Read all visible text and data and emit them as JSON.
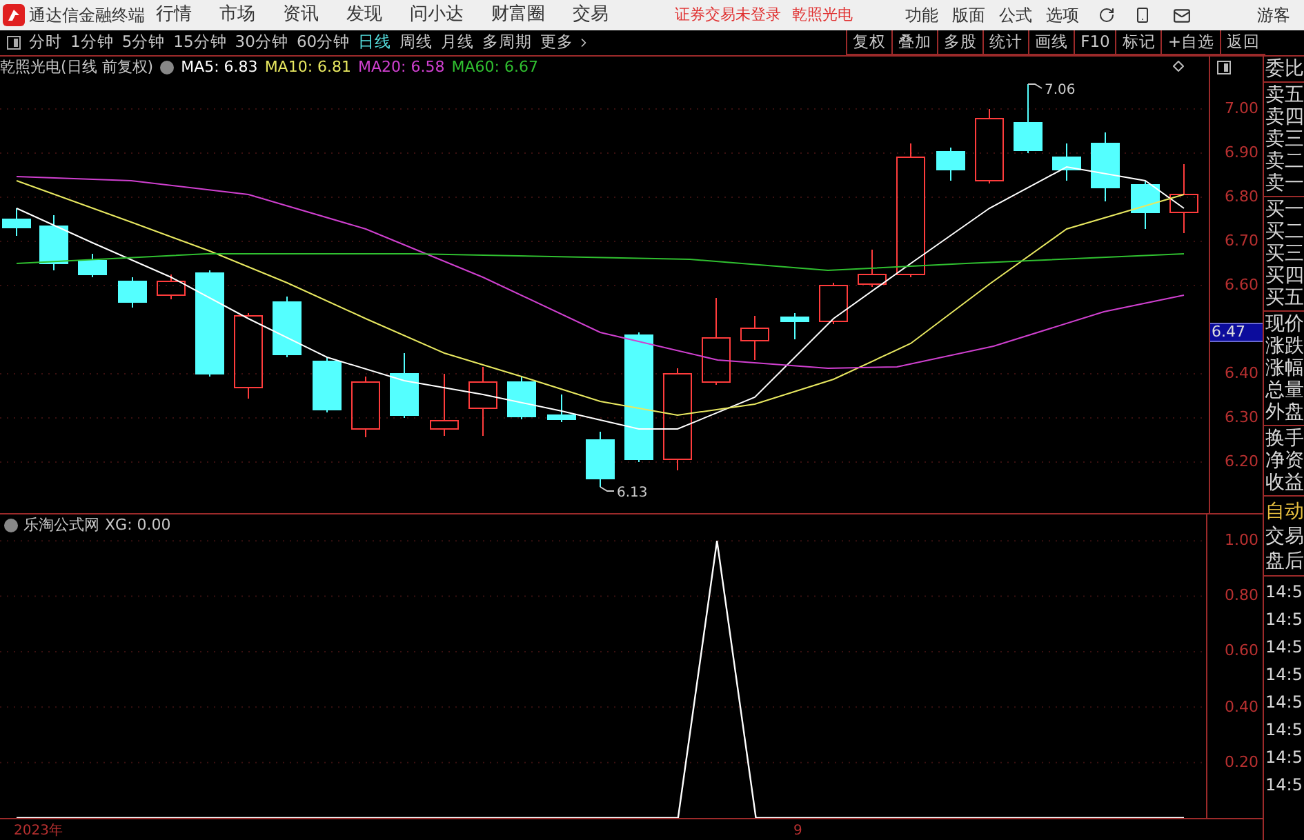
{
  "title_bar": {
    "app_name": "通达信金融终端",
    "menu": [
      "行情",
      "市场",
      "资讯",
      "发现",
      "问小达",
      "财富圈",
      "交易"
    ],
    "status": "证券交易未登录",
    "stock": "乾照光电",
    "right_menu": [
      "功能",
      "版面",
      "公式",
      "选项"
    ],
    "user": "游客"
  },
  "period_tabs": [
    {
      "label": "分时",
      "selected": false
    },
    {
      "label": "1分钟",
      "selected": false
    },
    {
      "label": "5分钟",
      "selected": false
    },
    {
      "label": "15分钟",
      "selected": false
    },
    {
      "label": "30分钟",
      "selected": false
    },
    {
      "label": "60分钟",
      "selected": false
    },
    {
      "label": "日线",
      "selected": true
    },
    {
      "label": "周线",
      "selected": false
    },
    {
      "label": "月线",
      "selected": false
    },
    {
      "label": "多周期",
      "selected": false
    },
    {
      "label": "更多",
      "selected": false
    }
  ],
  "tool_buttons": [
    "复权",
    "叠加",
    "多股",
    "统计",
    "画线",
    "F10",
    "标记",
    "+自选",
    "返回"
  ],
  "main_chart": {
    "title": "乾照光电(日线 前复权)",
    "ma": [
      {
        "label": "MA5: 6.83",
        "color": "#ffffff"
      },
      {
        "label": "MA10: 6.81",
        "color": "#e8e860"
      },
      {
        "label": "MA20: 6.58",
        "color": "#d040d0"
      },
      {
        "label": "MA60: 6.67",
        "color": "#30c030"
      }
    ],
    "price_labels": [
      "7.00",
      "6.90",
      "6.80",
      "6.70",
      "6.60",
      "6.40",
      "6.30",
      "6.20"
    ],
    "current_price": "6.47",
    "high_label": "7.06",
    "low_label": "6.13"
  },
  "indicator": {
    "title": "乐淘公式网",
    "reading": ": 0.00",
    "chart_data": {
      "type": "line",
      "series": [
        {
          "name": "XG",
          "color": "#ffffff",
          "values": [
            0,
            0,
            0,
            0,
            0,
            0,
            0,
            0,
            0,
            0,
            0,
            0,
            0,
            0,
            0,
            0,
            0,
            0,
            1,
            0,
            0,
            0,
            0,
            0,
            0,
            0,
            0,
            0,
            0,
            0,
            0
          ]
        }
      ],
      "ylim": [
        0,
        1.095
      ],
      "grid": true,
      "yticks": [
        {
          "value": 0.2,
          "label": "0.20"
        },
        {
          "value": 0.4,
          "label": "0.40"
        },
        {
          "value": 0.6,
          "label": "0.60"
        },
        {
          "value": 0.8,
          "label": "0.80"
        },
        {
          "value": 1,
          "label": "1.00"
        }
      ]
    }
  },
  "x_axis": [
    "2023年",
    "9"
  ],
  "quote_panel": {
    "groups": [
      [
        "委比"
      ],
      [
        "卖五",
        "卖四",
        "卖三",
        "卖二",
        "卖一"
      ],
      [
        "买一",
        "买二",
        "买三",
        "买四",
        "买五"
      ],
      [
        "现价",
        "涨跌",
        "涨幅",
        "总量",
        "外盘"
      ],
      [
        "换手",
        "净资",
        "收益"
      ]
    ],
    "auto": "自动",
    "session": [
      "交易",
      "盘后"
    ],
    "times": [
      "14:5",
      "14:5",
      "14:5",
      "14:5",
      "14:5",
      "14:5",
      "14:5",
      "14:5"
    ]
  }
}
